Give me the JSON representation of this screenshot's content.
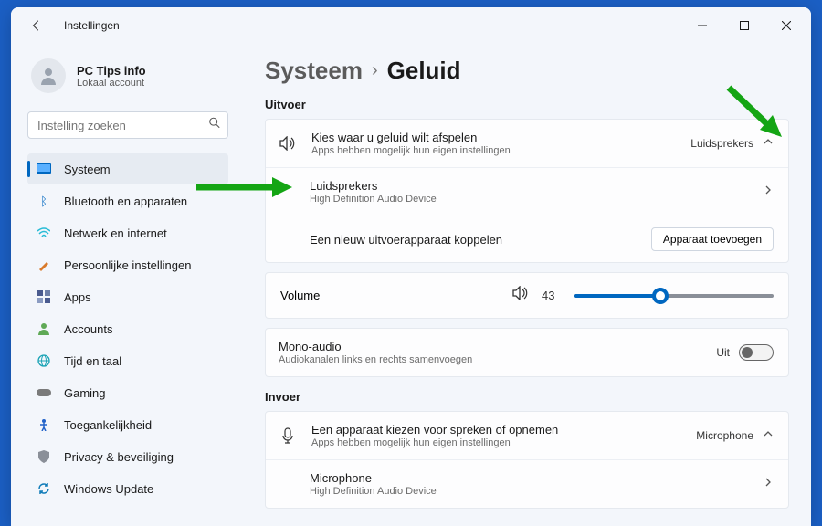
{
  "titlebar": {
    "title": "Instellingen"
  },
  "user": {
    "name": "PC Tips info",
    "sub": "Lokaal account"
  },
  "search": {
    "placeholder": "Instelling zoeken"
  },
  "nav": {
    "items": [
      {
        "label": "Systeem",
        "icon_color": "#0067c0"
      },
      {
        "label": "Bluetooth en apparaten",
        "icon_color": "#0067c0"
      },
      {
        "label": "Netwerk en internet",
        "icon_color": "#27bcd6"
      },
      {
        "label": "Persoonlijke instellingen",
        "icon_color": "#d97a2b"
      },
      {
        "label": "Apps",
        "icon_color": "#4a5b8f"
      },
      {
        "label": "Accounts",
        "icon_color": "#5fa956"
      },
      {
        "label": "Tijd en taal",
        "icon_color": "#1aa3b5"
      },
      {
        "label": "Gaming",
        "icon_color": "#7a7a7a"
      },
      {
        "label": "Toegankelijkheid",
        "icon_color": "#2262c9"
      },
      {
        "label": "Privacy & beveiliging",
        "icon_color": "#8a8f98"
      },
      {
        "label": "Windows Update",
        "icon_color": "#0f7bb8"
      }
    ]
  },
  "breadcrumb": {
    "parent": "Systeem",
    "current": "Geluid"
  },
  "section_output": "Uitvoer",
  "output": {
    "choose_title": "Kies waar u geluid wilt afspelen",
    "choose_sub": "Apps hebben mogelijk hun eigen instellingen",
    "choose_value": "Luidsprekers",
    "device_title": "Luidsprekers",
    "device_sub": "High Definition Audio Device",
    "pair_title": "Een nieuw uitvoerapparaat koppelen",
    "pair_button": "Apparaat toevoegen"
  },
  "volume": {
    "label": "Volume",
    "value": "43",
    "percent": 43
  },
  "mono": {
    "title": "Mono-audio",
    "sub": "Audiokanalen links en rechts samenvoegen",
    "state": "Uit"
  },
  "section_input": "Invoer",
  "input": {
    "choose_title": "Een apparaat kiezen voor spreken of opnemen",
    "choose_sub": "Apps hebben mogelijk hun eigen instellingen",
    "choose_value": "Microphone",
    "device_title": "Microphone",
    "device_sub": "High Definition Audio Device"
  },
  "colors": {
    "accent": "#0067c0",
    "arrow": "#14a514"
  }
}
